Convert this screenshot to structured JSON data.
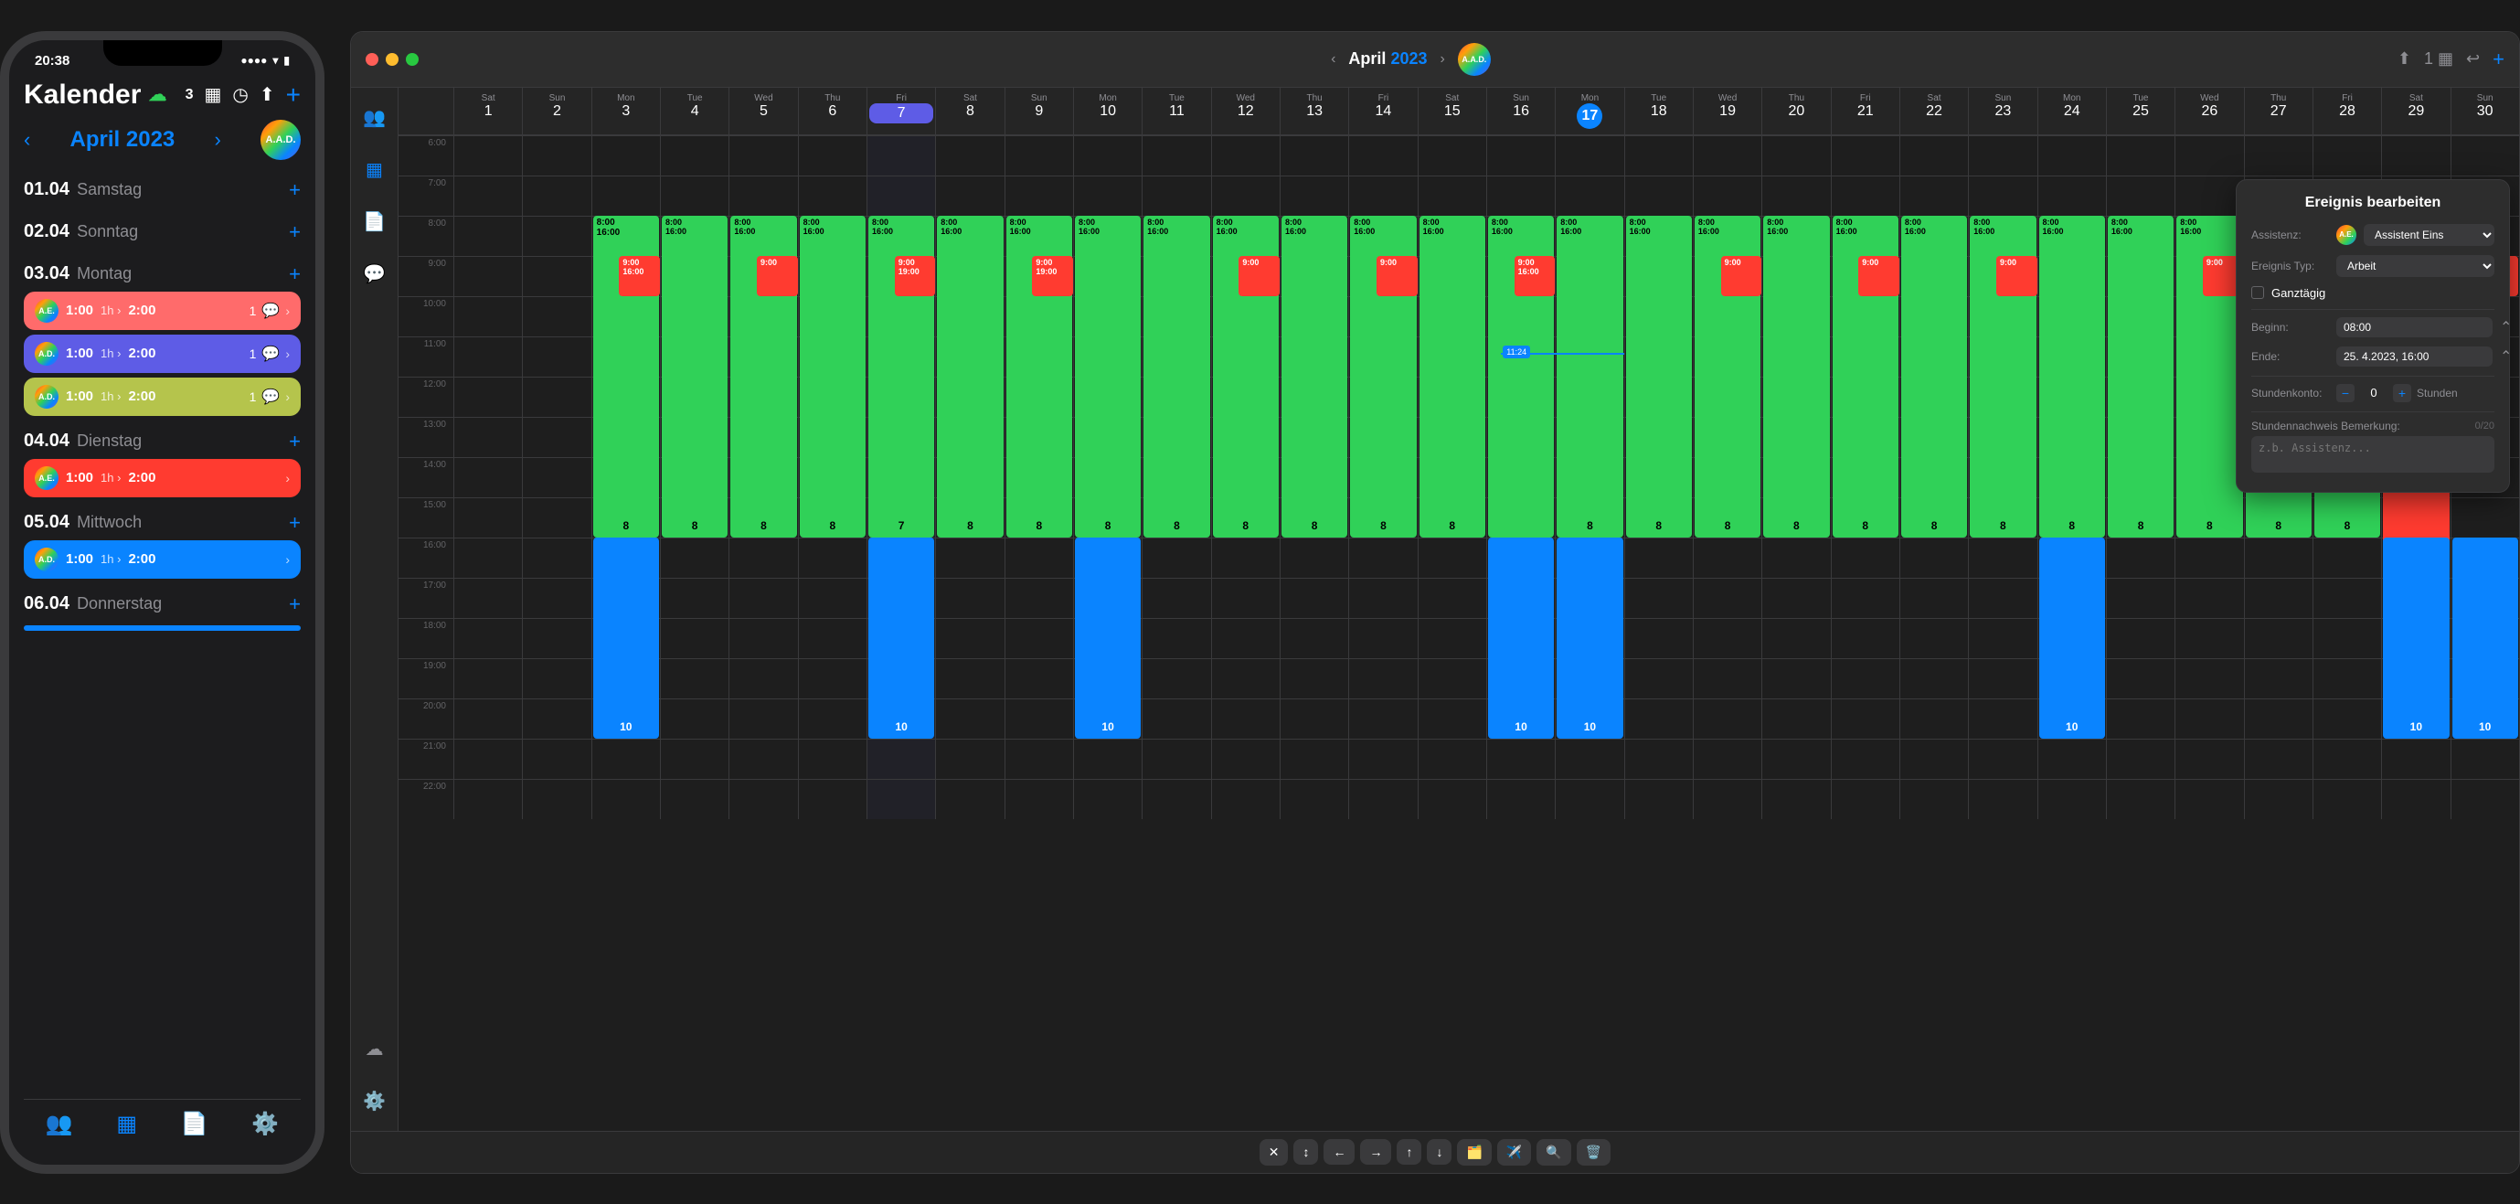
{
  "phone": {
    "status": {
      "time": "20:38",
      "signal": "●●●●",
      "wifi": "WiFi",
      "battery": "🔋"
    },
    "app_title": "Kalender",
    "badge_count": "3",
    "month_title": "April",
    "month_year": "2023",
    "dates": [
      {
        "num": "01.04",
        "day": "Samstag",
        "events": []
      },
      {
        "num": "02.04",
        "day": "Sonntag",
        "events": []
      },
      {
        "num": "03.04",
        "day": "Montag",
        "events": [
          {
            "avatar": "A.E.",
            "time": "1:00",
            "duration": "1h",
            "end": "2:00",
            "badge": "1",
            "color": "salmon"
          },
          {
            "avatar": "A.D.",
            "time": "1:00",
            "duration": "1h",
            "end": "2:00",
            "badge": "1",
            "color": "blue-purple"
          },
          {
            "avatar": "A.D.",
            "time": "1:00",
            "duration": "1h",
            "end": "2:00",
            "badge": "1",
            "color": "olive"
          }
        ]
      },
      {
        "num": "04.04",
        "day": "Dienstag",
        "events": [
          {
            "avatar": "A.E.",
            "time": "1:00",
            "duration": "1h",
            "end": "2:00",
            "badge": "",
            "color": "red"
          }
        ]
      },
      {
        "num": "05.04",
        "day": "Mittwoch",
        "events": [
          {
            "avatar": "A.D.",
            "time": "1:00",
            "duration": "1h",
            "end": "2:00",
            "badge": "",
            "color": "blue"
          }
        ]
      },
      {
        "num": "06.04",
        "day": "Donnerstag",
        "events": []
      }
    ],
    "bottom_nav": [
      {
        "label": "Personen",
        "icon": "👥",
        "active": false
      },
      {
        "label": "Kalender",
        "icon": "📅",
        "active": true
      },
      {
        "label": "Dokumente",
        "icon": "📄",
        "active": false
      },
      {
        "label": "Einstellungen",
        "icon": "⚙️",
        "active": false
      }
    ]
  },
  "mac": {
    "title": "April",
    "year": "2023",
    "days": [
      {
        "name": "Sat",
        "num": "1"
      },
      {
        "name": "Sun",
        "num": "2"
      },
      {
        "name": "Mon",
        "num": "3"
      },
      {
        "name": "Tue",
        "num": "4"
      },
      {
        "name": "Wed",
        "num": "5"
      },
      {
        "name": "Thu",
        "num": "6"
      },
      {
        "name": "Fri",
        "num": "7",
        "highlight": "purple"
      },
      {
        "name": "Sat",
        "num": "8"
      },
      {
        "name": "Sun",
        "num": "9"
      },
      {
        "name": "Mon",
        "num": "10"
      },
      {
        "name": "Tue",
        "num": "11"
      },
      {
        "name": "Wed",
        "num": "12"
      },
      {
        "name": "Thu",
        "num": "13"
      },
      {
        "name": "Fri",
        "num": "14"
      },
      {
        "name": "Sat",
        "num": "15"
      },
      {
        "name": "Sun",
        "num": "16"
      },
      {
        "name": "Mon",
        "num": "17",
        "today": true
      },
      {
        "name": "Tue",
        "num": "18"
      },
      {
        "name": "Wed",
        "num": "19"
      },
      {
        "name": "Thu",
        "num": "20"
      },
      {
        "name": "Fri",
        "num": "21"
      },
      {
        "name": "Sat",
        "num": "22"
      },
      {
        "name": "Sun",
        "num": "23"
      },
      {
        "name": "Mon",
        "num": "24"
      },
      {
        "name": "Tue",
        "num": "25"
      },
      {
        "name": "Wed",
        "num": "26"
      },
      {
        "name": "Thu",
        "num": "27"
      },
      {
        "name": "Fri",
        "num": "28"
      },
      {
        "name": "Sat",
        "num": "29"
      },
      {
        "name": "Sun",
        "num": "30"
      }
    ],
    "times": [
      "6:00",
      "7:00",
      "8:00",
      "9:00",
      "10:00",
      "11:00",
      "12:00",
      "13:00",
      "14:00",
      "15:00",
      "16:00",
      "17:00",
      "18:00",
      "19:00",
      "20:00",
      "21:00",
      "22:00"
    ],
    "current_time": "11:24",
    "panel": {
      "title": "Ereignis bearbeiten",
      "assistant_label": "Assistenz:",
      "assistant_avatar": "A.E.",
      "assistant_name": "Assistent Eins",
      "type_label": "Ereignis Typ:",
      "type_value": "Arbeit",
      "all_day_label": "Ganztägig",
      "begin_label": "Beginn:",
      "begin_value": "08:00",
      "end_label": "Ende:",
      "end_value": "25. 4.2023, 16:00",
      "hours_label": "Stundenkonto:",
      "hours_count": "0",
      "hours_unit": "Stunden",
      "remark_label": "Stundennachweis Bemerkung:",
      "remark_chars": "0/20",
      "remark_placeholder": "z.b. Assistenz..."
    },
    "toolbar_buttons": [
      "✕",
      "↕",
      "←",
      "→",
      "↑",
      "↓",
      "🗂️",
      "✈️",
      "🔍",
      "🗑️"
    ]
  }
}
